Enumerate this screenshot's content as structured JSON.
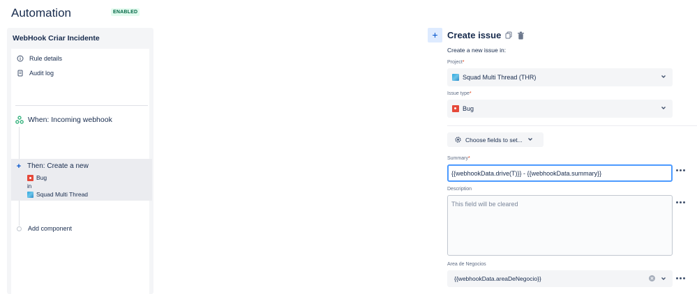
{
  "header": {
    "title": "Automation",
    "status": "ENABLED"
  },
  "colors": {
    "accent": "#0052cc",
    "enabled_badge": "#006644",
    "bug": "#e5493a",
    "focus_border": "#4c9aff"
  },
  "sidebar": {
    "rule_name": "WebHook Criar Incidente",
    "links": [
      {
        "label": "Rule details",
        "icon": "info-icon"
      },
      {
        "label": "Audit log",
        "icon": "log-icon"
      }
    ],
    "trigger": {
      "label": "When: Incoming webhook",
      "icon": "webhook-icon"
    },
    "action": {
      "title": "Then: Create a new",
      "issue_type": "Bug",
      "connector": "in",
      "project": "Squad Multi Thread"
    },
    "add_component": "Add component"
  },
  "panel": {
    "title": "Create issue",
    "subtitle": "Create a new issue in:",
    "project_label": "Project",
    "project_value": "Squad Multi Thread (THR)",
    "issue_type_label": "Issue type",
    "issue_type_value": "Bug",
    "choose_fields": "Choose fields to set...",
    "summary_label": "Summary",
    "summary_value": "{{webhookData.drive(T)}} - {{webhookData.summary}}",
    "description_label": "Description",
    "description_placeholder": "This field will be cleared",
    "area_label": "Area de Negocios",
    "area_value": "{{webhookData.areaDeNegocio}}",
    "required_mark": "*"
  }
}
